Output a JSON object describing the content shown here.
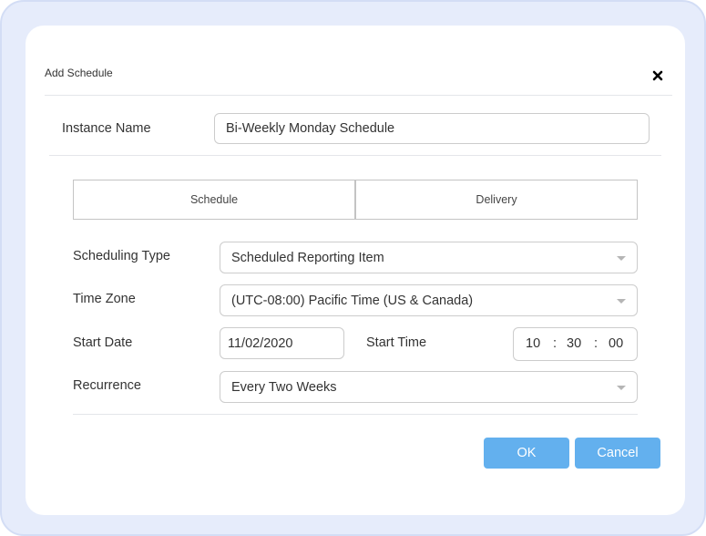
{
  "dialog": {
    "title": "Add Schedule",
    "close_icon": "close-icon"
  },
  "instance": {
    "label": "Instance Name",
    "value": "Bi-Weekly Monday Schedule"
  },
  "tabs": [
    {
      "label": "Schedule"
    },
    {
      "label": "Delivery"
    }
  ],
  "form": {
    "scheduling_type": {
      "label": "Scheduling Type",
      "value": "Scheduled Reporting Item"
    },
    "time_zone": {
      "label": "Time Zone",
      "value": "(UTC-08:00) Pacific Time (US & Canada)"
    },
    "start_date": {
      "label": "Start Date",
      "value": "11/02/2020"
    },
    "start_time": {
      "label": "Start Time",
      "hour": "10",
      "minute": "30",
      "second": "00",
      "separator": ":"
    },
    "recurrence": {
      "label": "Recurrence",
      "value": "Every Two Weeks"
    }
  },
  "buttons": {
    "ok": "OK",
    "cancel": "Cancel"
  },
  "colors": {
    "frame_bg": "#e6ecfb",
    "button_bg": "#63b0ee",
    "button_text": "#ffffff"
  }
}
